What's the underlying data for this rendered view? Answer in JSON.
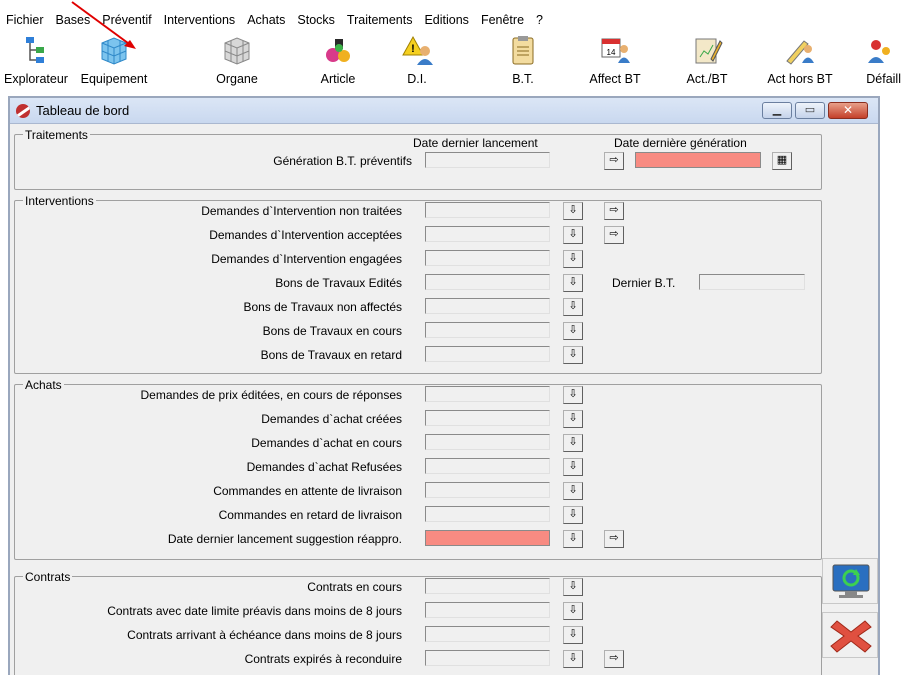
{
  "menu": [
    "Fichier",
    "Bases",
    "Préventif",
    "Interventions",
    "Achats",
    "Stocks",
    "Traitements",
    "Editions",
    "Fenêtre",
    "?"
  ],
  "toolbar": [
    {
      "label": "Explorateur",
      "icon": "explorer-tree-icon"
    },
    {
      "label": "Equipement",
      "icon": "equipment-cube-icon"
    },
    {
      "label": "Organe",
      "icon": "organ-cube-icon"
    },
    {
      "label": "Article",
      "icon": "article-icon"
    },
    {
      "label": "D.I.",
      "icon": "warning-user-icon"
    },
    {
      "label": "B.T.",
      "icon": "clipboard-icon"
    },
    {
      "label": "Affect BT",
      "icon": "calendar-users-icon"
    },
    {
      "label": "Act./BT",
      "icon": "pencil-chart-icon"
    },
    {
      "label": "Act hors BT",
      "icon": "pencil-user-icon"
    },
    {
      "label": "Défaill",
      "icon": "failure-icon"
    }
  ],
  "window": {
    "title": "Tableau de bord",
    "calendar_day": "14"
  },
  "traitements": {
    "group_label": "Traitements",
    "col_last_launch": "Date dernier lancement",
    "col_last_generation": "Date dernière génération",
    "row_label": "Génération B.T. préventifs"
  },
  "interventions": {
    "group_label": "Interventions",
    "rows": [
      "Demandes d`Intervention non traitées",
      "Demandes d`Intervention acceptées",
      "Demandes d`Intervention engagées",
      "Bons de Travaux  Edités",
      "Bons de Travaux non affectés",
      "Bons de Travaux en cours",
      "Bons de Travaux en retard"
    ],
    "last_bt_label": "Dernier B.T."
  },
  "achats": {
    "group_label": "Achats",
    "rows": [
      "Demandes de prix éditées, en cours de réponses",
      "Demandes d`achat créées",
      "Demandes d`achat en cours",
      "Demandes d`achat Refusées",
      "Commandes en attente de livraison",
      "Commandes en retard de livraison",
      "Date dernier lancement suggestion réappro."
    ]
  },
  "contrats": {
    "group_label": "Contrats",
    "rows": [
      "Contrats en cours",
      "Contrats avec date limite préavis dans moins de   8   jours",
      "Contrats arrivant à échéance dans moins de   8   jours",
      "Contrats expirés à reconduire"
    ]
  },
  "colors": {
    "highlight_field": "#f88b82",
    "annotation_arrow": "#e00000"
  }
}
